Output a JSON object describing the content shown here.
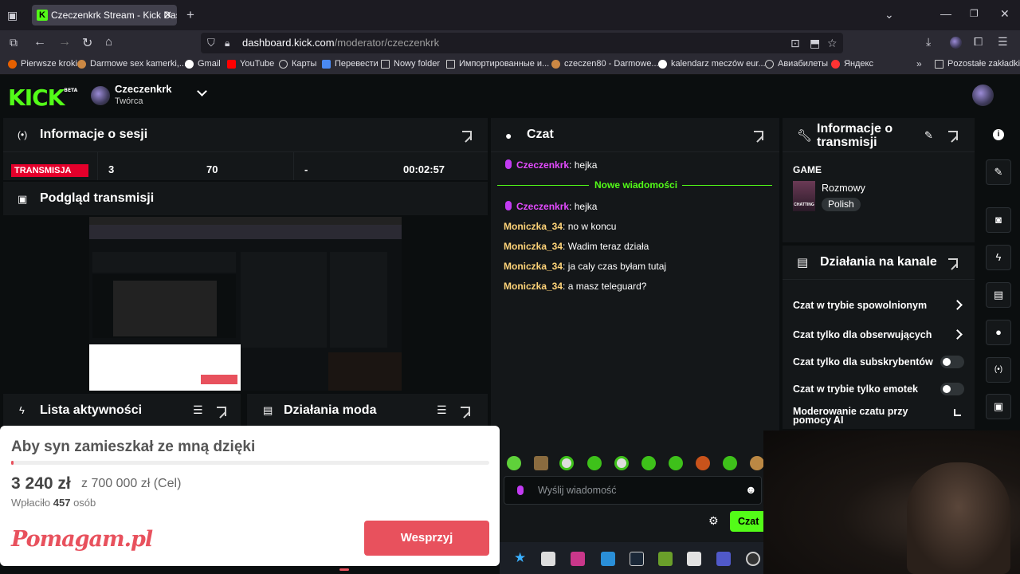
{
  "browser": {
    "tab_title": "Czeczenkrk Stream - Kick Dashb",
    "tab_favicon": "K",
    "url_host": "dashboard.kick.com",
    "url_path": "/moderator/czeczenkrk",
    "bookmarks": [
      "Pierwsze kroki",
      "Darmowe sex kamerki,...",
      "Gmail",
      "YouTube",
      "Карты",
      "Перевести",
      "Nowy folder",
      "Импортированные и...",
      "czeczen80 - Darmowe...",
      "kalendarz meczów eur...",
      "Авиабилеты",
      "Яндекс"
    ],
    "other_bookmarks": "Pozostałe zakładki"
  },
  "header": {
    "logo": "KICK",
    "logo_badge": "BETA",
    "channel_name": "Czeczenkrk",
    "channel_role": "Twórca"
  },
  "session": {
    "title": "Informacje o sesji",
    "live_badge": "TRANSMISJA",
    "viewers": "3",
    "followers": "70",
    "subs": "-",
    "uptime": "00:02:57"
  },
  "preview": {
    "title": "Podgląd transmisji"
  },
  "activity": {
    "title": "Lista aktywności"
  },
  "mod_actions": {
    "title": "Działania moda"
  },
  "chat": {
    "title": "Czat",
    "new_messages": "Nowe wiadomości",
    "messages": [
      {
        "user": "Czeczenkrk",
        "text": ": hejka",
        "role": "creator"
      },
      {
        "user": "Czeczenkrk",
        "text": ": hejka",
        "role": "creator"
      },
      {
        "user": "Moniczka_34",
        "text": ": no w koncu",
        "role": "viewer"
      },
      {
        "user": "Moniczka_34",
        "text": ": Wadim teraz działa",
        "role": "viewer"
      },
      {
        "user": "Moniczka_34",
        "text": ": ja caly czas byłam tutaj",
        "role": "viewer"
      },
      {
        "user": "Moniczka_34",
        "text": ": a masz teleguard?",
        "role": "viewer"
      }
    ],
    "input_placeholder": "Wyślij wiadomość",
    "send_label": "Czat"
  },
  "stream_info": {
    "title": "Informacje o transmisji",
    "game_label": "GAME",
    "category": "Rozmowy",
    "category_thumb": "CHATTING",
    "language": "Polish"
  },
  "channel_actions": {
    "title": "Działania na kanale",
    "items": [
      {
        "label": "Czat w trybie spowolnionym",
        "control": "chevron"
      },
      {
        "label": "Czat tylko dla obserwujących",
        "control": "chevron"
      },
      {
        "label": "Czat tylko dla subskrybentów",
        "control": "toggle"
      },
      {
        "label": "Czat w trybie tylko emotek",
        "control": "toggle"
      },
      {
        "label": "Moderowanie czatu przy pomocy AI",
        "control": "external"
      }
    ]
  },
  "donation": {
    "title": "Aby syn zamieszkał ze mną dzięki",
    "amount": "3 240 zł",
    "goal": "z 700 000 zł (Cel)",
    "supporters_prefix": "Wpłaciło",
    "supporters_count": "457",
    "supporters_suffix": "osób",
    "progress_fraction": 0.0046,
    "brand": "Pomagam.pl",
    "button_label": "Wesprzyj"
  },
  "colors": {
    "kick_green": "#53fc18",
    "live_red": "#e4002b",
    "donate_red": "#e8515d",
    "creator_purple": "#e44bff",
    "viewer_yellow": "#ffd479"
  }
}
